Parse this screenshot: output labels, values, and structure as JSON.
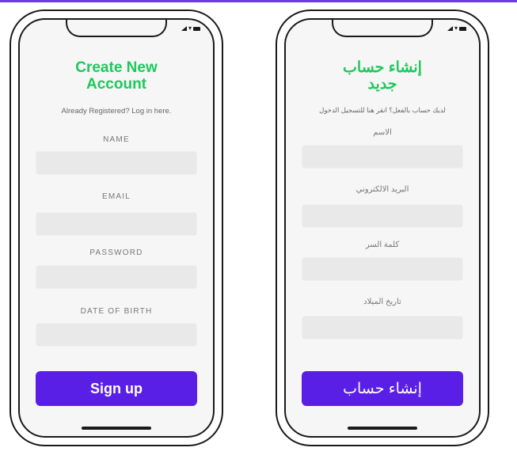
{
  "accent_color": "#5a1fe6",
  "title_color": "#1fc85d",
  "english": {
    "title_line1": "Create New",
    "title_line2": "Account",
    "login_prompt": "Already Registered? Log in here.",
    "fields": [
      {
        "label": "NAME",
        "value": ""
      },
      {
        "label": "EMAIL",
        "value": ""
      },
      {
        "label": "PASSWORD",
        "value": ""
      },
      {
        "label": "DATE OF BIRTH",
        "value": ""
      }
    ],
    "signup_label": "Sign up"
  },
  "arabic": {
    "title_line1": "إنشاء حساب",
    "title_line2": "جديد",
    "login_prompt": "لديك حساب بالفعل؟ انقر هنا للتسجيل الدخول",
    "fields": [
      {
        "label": "الاسم",
        "value": ""
      },
      {
        "label": "البريد الالكتروني",
        "value": ""
      },
      {
        "label": "كلمة السر",
        "value": ""
      },
      {
        "label": "تاريخ الميلاد",
        "value": ""
      }
    ],
    "signup_label": "إنشاء حساب"
  }
}
